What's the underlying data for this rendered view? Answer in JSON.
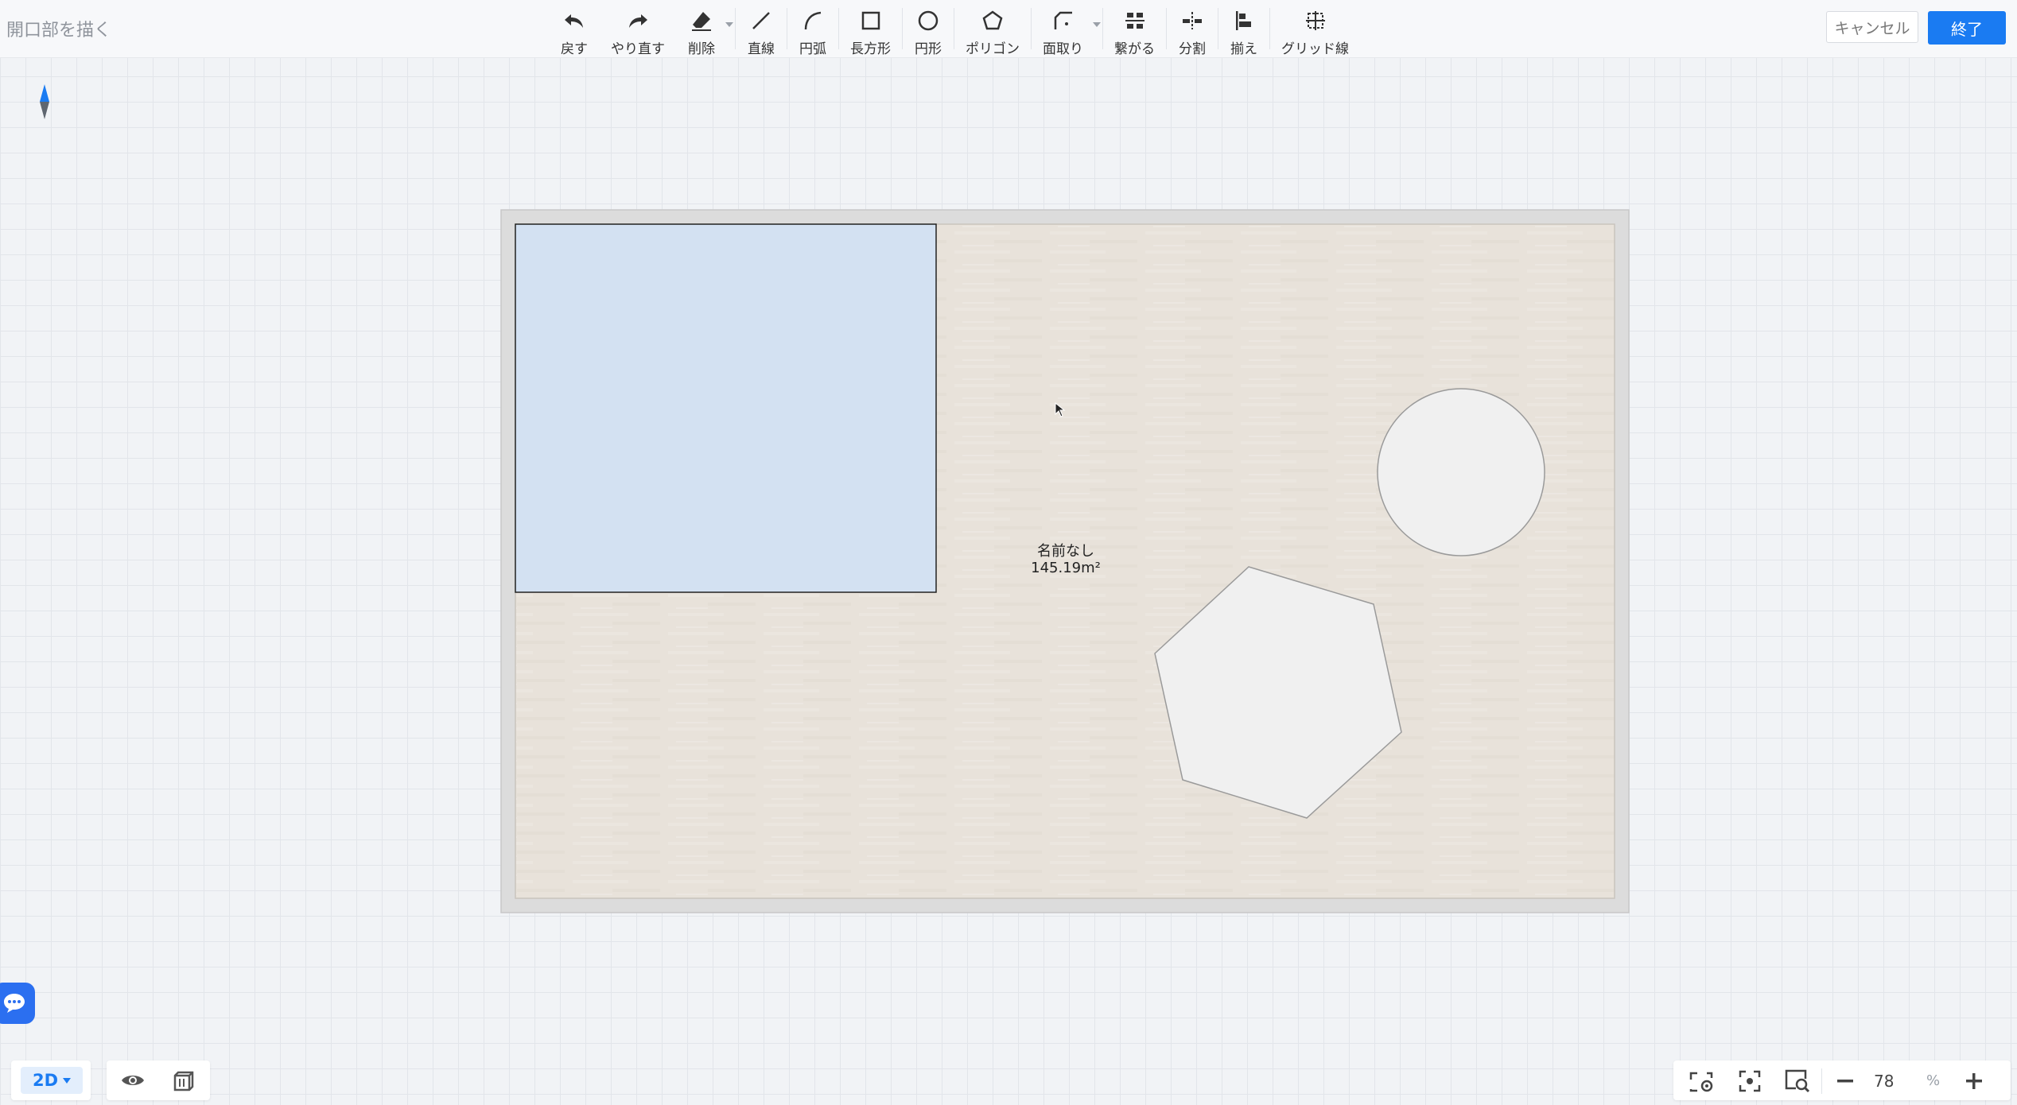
{
  "page": {
    "title": "開口部を描く"
  },
  "toolbar": {
    "undo": "戻す",
    "redo": "やり直す",
    "delete": "削除",
    "line": "直線",
    "arc": "円弧",
    "rectangle": "長方形",
    "circle": "円形",
    "polygon": "ポリゴン",
    "chamfer": "面取り",
    "connect": "繋がる",
    "split": "分割",
    "align": "揃え",
    "grid_line": "グリッド線"
  },
  "actions": {
    "cancel": "キャンセル",
    "finish": "終了"
  },
  "room": {
    "name": "名前なし",
    "area": "145.19m²"
  },
  "view": {
    "mode": "2D"
  },
  "zoom": {
    "value": "78",
    "unit": "%"
  },
  "icons": {
    "undo": "undo-icon",
    "redo": "redo-icon",
    "delete": "eraser-icon",
    "line": "line-icon",
    "arc": "arc-icon",
    "rectangle": "rectangle-icon",
    "circle": "circle-icon",
    "polygon": "pentagon-icon",
    "chamfer": "chamfer-icon",
    "connect": "connect-icon",
    "split": "split-icon",
    "align": "align-icon",
    "grid_line": "grid-line-icon",
    "compass": "compass-icon",
    "chat": "chat-icon",
    "eye": "eye-icon",
    "cube": "cube-icon",
    "view_settings": "view-settings-icon",
    "fit": "fit-view-icon",
    "zoom_area": "zoom-area-icon",
    "zoom_out": "minus-icon",
    "zoom_in": "plus-icon"
  },
  "colors": {
    "accent": "#1a7bf2",
    "floor": "#e8e2da",
    "selected_rect": "#d3e1f2",
    "opening": "#f0f0f0",
    "room_border": "#dcdcdc"
  }
}
